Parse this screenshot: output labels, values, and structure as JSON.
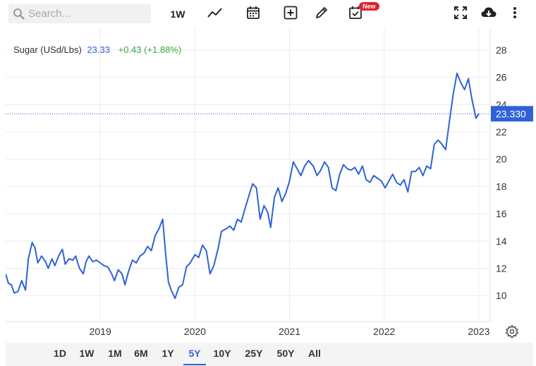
{
  "search": {
    "placeholder": "Search..."
  },
  "toolbar": {
    "interval_label": "1W",
    "new_badge": "New",
    "icons": [
      "search-icon",
      "line-chart-icon",
      "calendar-icon",
      "add-icon",
      "pencil-icon",
      "calendar-check-icon",
      "fullscreen-icon",
      "cloud-download-icon",
      "more-icon"
    ]
  },
  "header": {
    "symbol": "Sugar (USd/Lbs)",
    "last": "23.33",
    "change": "+0.43 (+1.88%)"
  },
  "price_tag": "23.330",
  "colors": {
    "line": "#2f62d6",
    "positive": "#3aa640",
    "badge": "#e3202a",
    "active": "#2f62d6"
  },
  "ranges": {
    "items": [
      "1D",
      "1W",
      "1M",
      "6M",
      "1Y",
      "5Y",
      "10Y",
      "25Y",
      "50Y",
      "All"
    ],
    "active": "5Y"
  },
  "chart_data": {
    "type": "line",
    "title": "Sugar (USd/Lbs)",
    "xlabel": "",
    "ylabel": "",
    "ylim": [
      8.1,
      29.6
    ],
    "y_ticks": [
      10,
      12,
      14,
      16,
      18,
      20,
      22,
      24,
      26,
      28
    ],
    "x_ticks": [
      {
        "label": "2019",
        "x": 2019.0
      },
      {
        "label": "2020",
        "x": 2020.0
      },
      {
        "label": "2021",
        "x": 2021.0
      },
      {
        "label": "2022",
        "x": 2022.0
      },
      {
        "label": "2023",
        "x": 2023.0
      }
    ],
    "xlim": [
      2018.0,
      2023.12
    ],
    "grid": true,
    "last_value": 23.33,
    "series": [
      {
        "values": [
          [
            2018.0,
            11.6
          ],
          [
            2018.03,
            10.9
          ],
          [
            2018.06,
            10.8
          ],
          [
            2018.09,
            10.2
          ],
          [
            2018.13,
            10.3
          ],
          [
            2018.17,
            11.1
          ],
          [
            2018.21,
            10.4
          ],
          [
            2018.24,
            12.7
          ],
          [
            2018.28,
            13.9
          ],
          [
            2018.31,
            13.5
          ],
          [
            2018.34,
            12.4
          ],
          [
            2018.38,
            12.9
          ],
          [
            2018.42,
            12.5
          ],
          [
            2018.45,
            12.0
          ],
          [
            2018.49,
            12.7
          ],
          [
            2018.52,
            12.2
          ],
          [
            2018.56,
            12.9
          ],
          [
            2018.6,
            13.4
          ],
          [
            2018.63,
            12.3
          ],
          [
            2018.67,
            12.7
          ],
          [
            2018.71,
            12.6
          ],
          [
            2018.74,
            12.9
          ],
          [
            2018.78,
            12.0
          ],
          [
            2018.82,
            11.6
          ],
          [
            2018.85,
            12.5
          ],
          [
            2018.88,
            12.9
          ],
          [
            2018.92,
            12.5
          ],
          [
            2018.96,
            12.6
          ],
          [
            2019.0,
            12.4
          ],
          [
            2019.04,
            12.2
          ],
          [
            2019.08,
            12.1
          ],
          [
            2019.12,
            11.6
          ],
          [
            2019.15,
            11.1
          ],
          [
            2019.19,
            11.9
          ],
          [
            2019.23,
            11.6
          ],
          [
            2019.26,
            10.8
          ],
          [
            2019.3,
            11.8
          ],
          [
            2019.34,
            12.6
          ],
          [
            2019.38,
            12.4
          ],
          [
            2019.42,
            12.9
          ],
          [
            2019.46,
            13.1
          ],
          [
            2019.5,
            13.6
          ],
          [
            2019.54,
            13.3
          ],
          [
            2019.58,
            14.4
          ],
          [
            2019.62,
            14.9
          ],
          [
            2019.66,
            15.6
          ],
          [
            2019.69,
            13.1
          ],
          [
            2019.72,
            11.0
          ],
          [
            2019.75,
            10.4
          ],
          [
            2019.79,
            9.8
          ],
          [
            2019.83,
            10.6
          ],
          [
            2019.87,
            10.8
          ],
          [
            2019.91,
            12.1
          ],
          [
            2019.95,
            12.4
          ],
          [
            2020.0,
            13.0
          ],
          [
            2020.04,
            12.8
          ],
          [
            2020.08,
            13.7
          ],
          [
            2020.12,
            13.3
          ],
          [
            2020.16,
            11.6
          ],
          [
            2020.2,
            12.2
          ],
          [
            2020.25,
            13.6
          ],
          [
            2020.28,
            14.7
          ],
          [
            2020.33,
            14.9
          ],
          [
            2020.37,
            15.1
          ],
          [
            2020.41,
            14.8
          ],
          [
            2020.45,
            15.6
          ],
          [
            2020.49,
            15.4
          ],
          [
            2020.53,
            16.4
          ],
          [
            2020.57,
            17.3
          ],
          [
            2020.61,
            18.2
          ],
          [
            2020.65,
            17.9
          ],
          [
            2020.69,
            15.6
          ],
          [
            2020.73,
            16.6
          ],
          [
            2020.77,
            16.1
          ],
          [
            2020.8,
            15.0
          ],
          [
            2020.84,
            17.2
          ],
          [
            2020.88,
            17.9
          ],
          [
            2020.92,
            16.9
          ],
          [
            2020.96,
            17.5
          ],
          [
            2021.0,
            18.4
          ],
          [
            2021.04,
            19.8
          ],
          [
            2021.08,
            19.3
          ],
          [
            2021.12,
            18.8
          ],
          [
            2021.16,
            19.5
          ],
          [
            2021.2,
            19.9
          ],
          [
            2021.25,
            19.5
          ],
          [
            2021.29,
            18.8
          ],
          [
            2021.33,
            19.2
          ],
          [
            2021.37,
            19.8
          ],
          [
            2021.41,
            19.4
          ],
          [
            2021.45,
            17.9
          ],
          [
            2021.49,
            17.7
          ],
          [
            2021.53,
            18.9
          ],
          [
            2021.57,
            19.6
          ],
          [
            2021.61,
            19.3
          ],
          [
            2021.65,
            19.2
          ],
          [
            2021.69,
            19.4
          ],
          [
            2021.73,
            18.9
          ],
          [
            2021.77,
            19.5
          ],
          [
            2021.81,
            18.5
          ],
          [
            2021.85,
            18.3
          ],
          [
            2021.89,
            18.8
          ],
          [
            2021.93,
            18.6
          ],
          [
            2021.97,
            18.4
          ],
          [
            2022.01,
            17.9
          ],
          [
            2022.05,
            18.4
          ],
          [
            2022.09,
            18.9
          ],
          [
            2022.13,
            18.3
          ],
          [
            2022.17,
            18.1
          ],
          [
            2022.21,
            18.5
          ],
          [
            2022.25,
            17.6
          ],
          [
            2022.29,
            19.1
          ],
          [
            2022.33,
            19.1
          ],
          [
            2022.37,
            19.4
          ],
          [
            2022.41,
            18.8
          ],
          [
            2022.45,
            19.5
          ],
          [
            2022.49,
            19.3
          ],
          [
            2022.53,
            21.1
          ],
          [
            2022.57,
            21.4
          ],
          [
            2022.61,
            21.1
          ],
          [
            2022.65,
            20.7
          ],
          [
            2022.69,
            22.8
          ],
          [
            2022.73,
            24.8
          ],
          [
            2022.77,
            26.3
          ],
          [
            2022.81,
            25.6
          ],
          [
            2022.85,
            25.1
          ],
          [
            2022.89,
            25.9
          ],
          [
            2022.93,
            24.3
          ],
          [
            2022.97,
            23.0
          ],
          [
            2023.0,
            23.33
          ]
        ]
      }
    ]
  }
}
